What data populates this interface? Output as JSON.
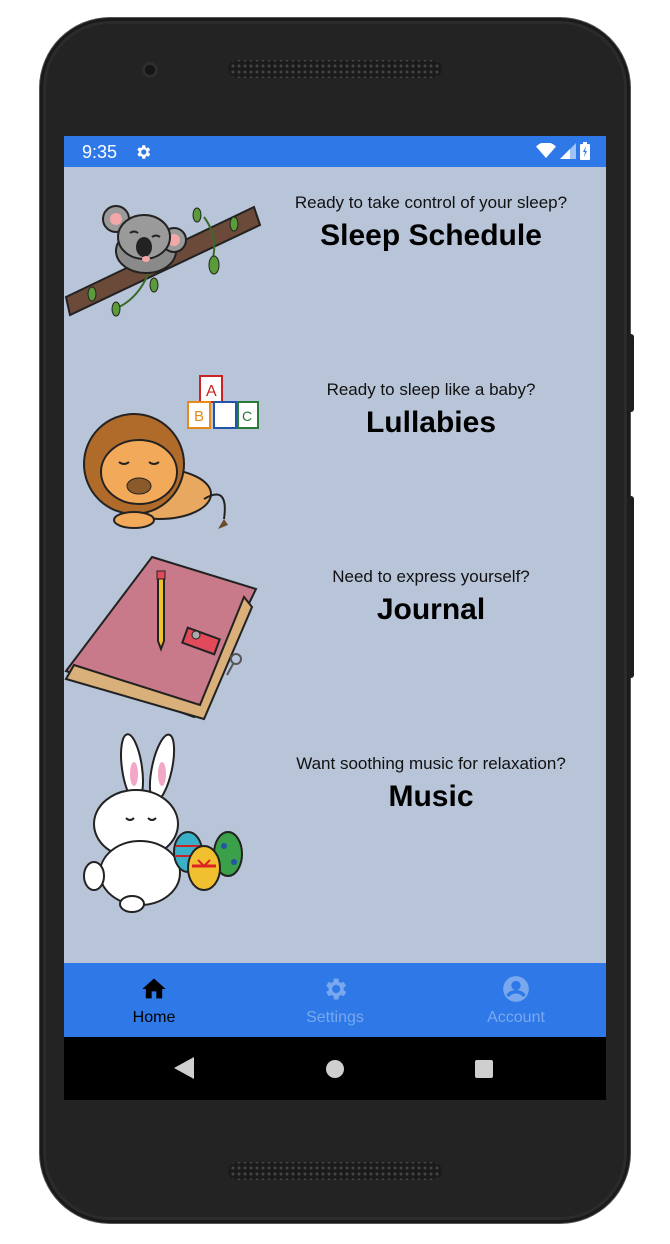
{
  "status_bar": {
    "time": "9:35",
    "settings_icon": "gear-icon",
    "wifi_icon": "wifi-icon",
    "signal_icon": "signal-icon",
    "battery_icon": "battery-icon"
  },
  "cards": [
    {
      "tagline": "Ready to take control of your sleep?",
      "title": "Sleep Schedule",
      "illustration": "koala-on-branch"
    },
    {
      "tagline": "Ready to sleep like a baby?",
      "title": "Lullabies",
      "illustration": "sleeping-lion-with-blocks"
    },
    {
      "tagline": "Need to express yourself?",
      "title": "Journal",
      "illustration": "pink-journal-with-pencil"
    },
    {
      "tagline": "Want soothing music for relaxation?",
      "title": "Music",
      "illustration": "bunny-with-eggs"
    }
  ],
  "bottom_nav": {
    "items": [
      {
        "label": "Home",
        "icon": "home-icon",
        "active": true
      },
      {
        "label": "Settings",
        "icon": "gear-icon",
        "active": false
      },
      {
        "label": "Account",
        "icon": "account-icon",
        "active": false
      }
    ]
  },
  "colors": {
    "accent": "#2e78e8",
    "background": "#b8c4d8",
    "inactive_nav": "#7aa8ee"
  }
}
